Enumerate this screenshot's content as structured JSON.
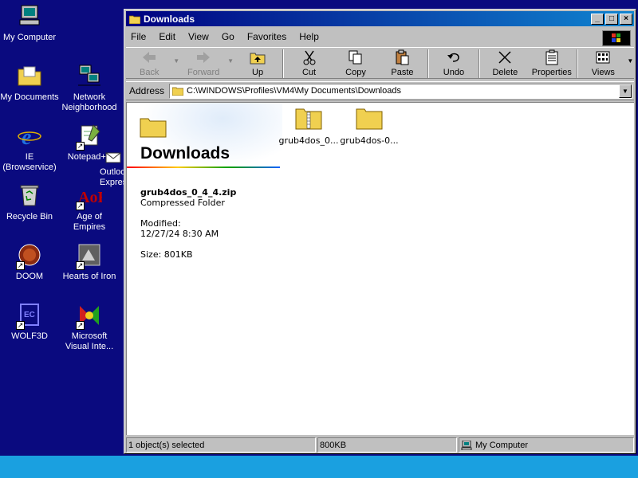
{
  "desktop": {
    "icons": [
      {
        "label": "My Computer"
      },
      {
        "label": "My Documents"
      },
      {
        "label": "Network Neighborhood"
      },
      {
        "label": "IE (Browservice)"
      },
      {
        "label": "Notepad++"
      },
      {
        "label": "Outlook Express"
      },
      {
        "label": "Recycle Bin"
      },
      {
        "label": "Age of Empires"
      },
      {
        "label": "DOOM"
      },
      {
        "label": "Hearts of Iron"
      },
      {
        "label": "WOLF3D"
      },
      {
        "label": "Microsoft Visual Inte..."
      }
    ]
  },
  "window": {
    "title": "Downloads",
    "menu": [
      "File",
      "Edit",
      "View",
      "Go",
      "Favorites",
      "Help"
    ],
    "toolbar": {
      "back": "Back",
      "forward": "Forward",
      "up": "Up",
      "cut": "Cut",
      "copy": "Copy",
      "paste": "Paste",
      "undo": "Undo",
      "delete": "Delete",
      "properties": "Properties",
      "views": "Views"
    },
    "address": {
      "label": "Address",
      "value": "C:\\WINDOWS\\Profiles\\VM4\\My Documents\\Downloads"
    },
    "webview": {
      "title": "Downloads",
      "selected_name": "grub4dos_0_4_4.zip",
      "selected_type": "Compressed Folder",
      "modified_label": "Modified:",
      "modified_value": "12/27/24 8:30 AM",
      "size_text": "Size: 801KB"
    },
    "files": [
      {
        "name": "grub4dos_0...",
        "kind": "zip-folder"
      },
      {
        "name": "grub4dos-0...",
        "kind": "folder"
      }
    ],
    "status": {
      "selection": "1 object(s) selected",
      "size": "800KB",
      "zone": "My Computer"
    }
  },
  "colors": {
    "desktop": "#0a0a7f",
    "titlebar_start": "#000080",
    "titlebar_end": "#1084d0",
    "taskbar": "#1aa0e0",
    "folder": "#f0d050"
  }
}
